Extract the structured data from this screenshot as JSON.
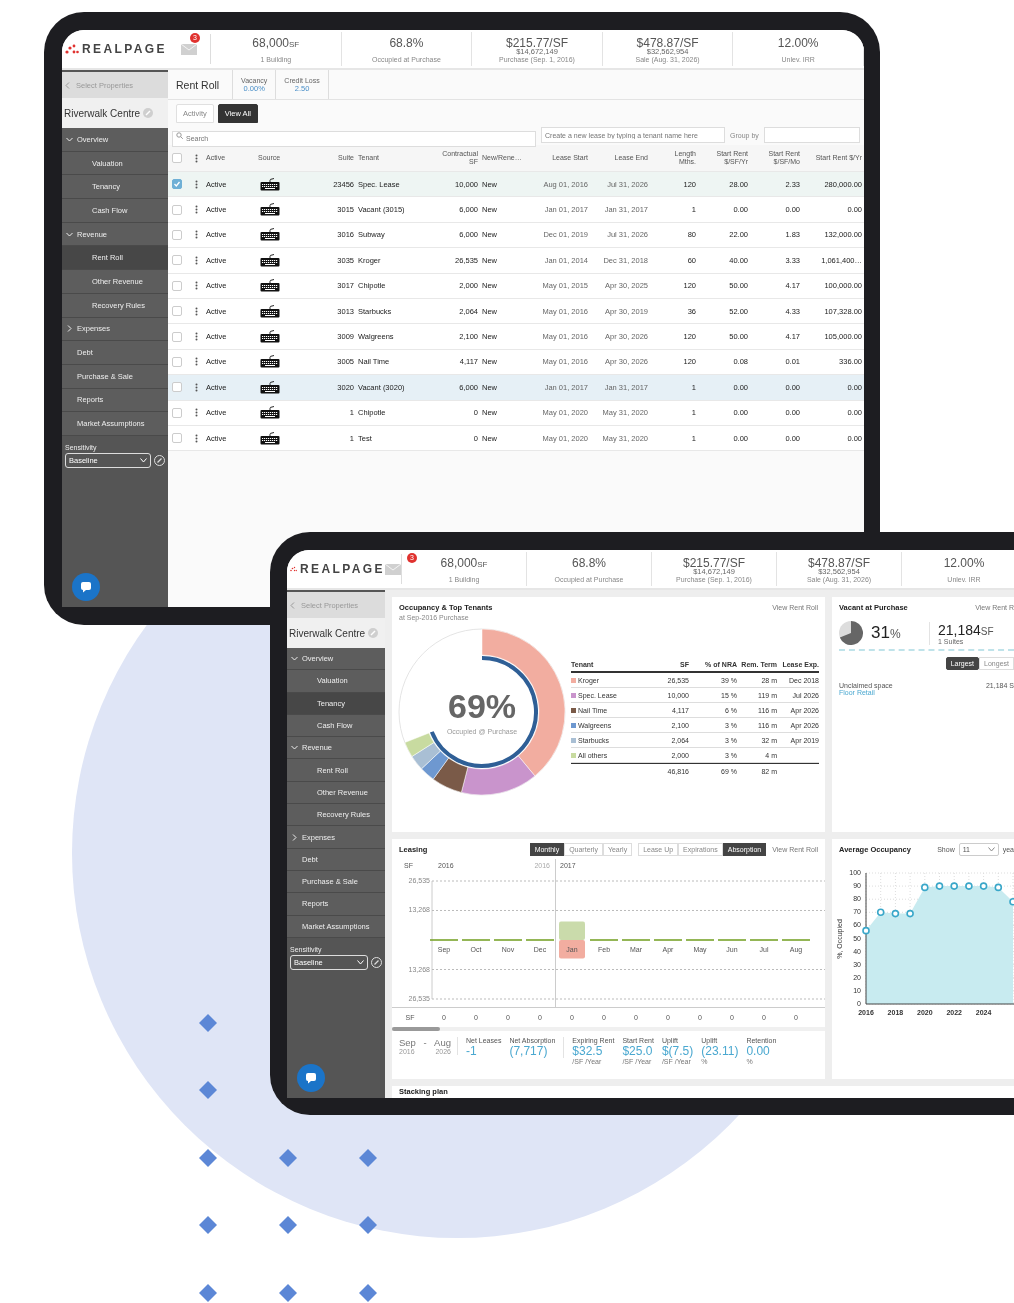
{
  "tablets": [
    {
      "kind": "rent_roll",
      "brand": "REALPAGE",
      "mail_count": "3",
      "stats": [
        {
          "value": "68,000",
          "unit": "SF",
          "caption": "1 Building"
        },
        {
          "value": "68.8%",
          "caption": "Occupied at Purchase"
        },
        {
          "value": "$215.77/SF",
          "sub": "$14,672,149",
          "caption": "Purchase (Sep. 1, 2016)"
        },
        {
          "value": "$478.87/SF",
          "sub": "$32,562,954",
          "caption": "Sale (Aug. 31, 2026)"
        },
        {
          "value": "12.00%",
          "caption": "Unlev. IRR"
        }
      ],
      "sidebar": {
        "back": "Select Properties",
        "property": "Riverwalk Centre",
        "nav": [
          {
            "label": "Overview",
            "expanded": true,
            "selected": false,
            "children": [
              {
                "label": "Valuation",
                "selected": false
              },
              {
                "label": "Tenancy",
                "selected": false
              },
              {
                "label": "Cash Flow",
                "selected": false
              }
            ]
          },
          {
            "label": "Revenue",
            "expanded": true,
            "selected": false,
            "children": [
              {
                "label": "Rent Roll",
                "selected": true
              },
              {
                "label": "Other Revenue",
                "selected": false
              },
              {
                "label": "Recovery Rules",
                "selected": false
              }
            ]
          },
          {
            "label": "Expenses",
            "expanded": false,
            "selected": false
          },
          {
            "label": "Debt",
            "selected": false
          },
          {
            "label": "Purchase & Sale",
            "selected": false
          },
          {
            "label": "Reports",
            "selected": false
          },
          {
            "label": "Market Assumptions",
            "selected": false
          }
        ],
        "sensitivity_label": "Sensitivity",
        "sensitivity": "Baseline"
      },
      "rent_roll": {
        "title": "Rent Roll",
        "metrics": [
          {
            "label": "Vacancy",
            "value": "0.00%"
          },
          {
            "label": "Credit Loss",
            "value": "2.50"
          }
        ],
        "tabs": [
          {
            "label": "Activity",
            "selected": false
          },
          {
            "label": "View All",
            "selected": true
          }
        ],
        "search": {
          "placeholder": "Search"
        },
        "new_lease": {
          "placeholder": "Create a new lease by typing a tenant name here"
        },
        "group_by": {
          "label": "Group by"
        },
        "all_checked": false,
        "columns": [
          "Active",
          "Source",
          "Suite",
          "Tenant",
          "Contractual SF",
          "New/Rene…",
          "Lease Start",
          "Lease End",
          "Length Mths.",
          "Start Rent $/SF/Yr",
          "Start Rent $/SF/Mo",
          "Start Rent $/Yr"
        ],
        "rows": [
          {
            "checked": true,
            "selected": true,
            "cells": [
              "Active",
              "",
              "23456",
              "Spec. Lease",
              "10,000",
              "New",
              "Aug 01, 2016",
              "Jul 31, 2026",
              "120",
              "28.00",
              "2.33",
              "280,000.00"
            ]
          },
          {
            "checked": false,
            "selected": false,
            "cells": [
              "Active",
              "",
              "3015",
              "Vacant (3015)",
              "6,000",
              "New",
              "Jan 01, 2017",
              "Jan 31, 2017",
              "1",
              "0.00",
              "0.00",
              "0.00"
            ]
          },
          {
            "checked": false,
            "selected": false,
            "cells": [
              "Active",
              "",
              "3016",
              "Subway",
              "6,000",
              "New",
              "Dec 01, 2019",
              "Jul 31, 2026",
              "80",
              "22.00",
              "1.83",
              "132,000.00"
            ]
          },
          {
            "checked": false,
            "selected": false,
            "cells": [
              "Active",
              "",
              "3035",
              "Kroger",
              "26,535",
              "New",
              "Jan 01, 2014",
              "Dec 31, 2018",
              "60",
              "40.00",
              "3.33",
              "1,061,400…"
            ]
          },
          {
            "checked": false,
            "selected": false,
            "cells": [
              "Active",
              "",
              "3017",
              "Chipotle",
              "2,000",
              "New",
              "May 01, 2015",
              "Apr 30, 2025",
              "120",
              "50.00",
              "4.17",
              "100,000.00"
            ]
          },
          {
            "checked": false,
            "selected": false,
            "cells": [
              "Active",
              "",
              "3013",
              "Starbucks",
              "2,064",
              "New",
              "May 01, 2016",
              "Apr 30, 2019",
              "36",
              "52.00",
              "4.33",
              "107,328.00"
            ]
          },
          {
            "checked": false,
            "selected": false,
            "cells": [
              "Active",
              "",
              "3009",
              "Walgreens",
              "2,100",
              "New",
              "May 01, 2016",
              "Apr 30, 2026",
              "120",
              "50.00",
              "4.17",
              "105,000.00"
            ]
          },
          {
            "checked": false,
            "selected": false,
            "cells": [
              "Active",
              "",
              "3005",
              "Nail Time",
              "4,117",
              "New",
              "May 01, 2016",
              "Apr 30, 2026",
              "120",
              "0.08",
              "0.01",
              "336.00"
            ]
          },
          {
            "checked": false,
            "selected": true,
            "cells": [
              "Active",
              "",
              "3020",
              "Vacant (3020)",
              "6,000",
              "New",
              "Jan 01, 2017",
              "Jan 31, 2017",
              "1",
              "0.00",
              "0.00",
              "0.00"
            ]
          },
          {
            "checked": false,
            "selected": false,
            "cells": [
              "Active",
              "",
              "1",
              "Chipotle",
              "0",
              "New",
              "May 01, 2020",
              "May 31, 2020",
              "1",
              "0.00",
              "0.00",
              "0.00"
            ]
          },
          {
            "checked": false,
            "selected": false,
            "cells": [
              "Active",
              "",
              "1",
              "Test",
              "0",
              "New",
              "May 01, 2020",
              "May 31, 2020",
              "1",
              "0.00",
              "0.00",
              "0.00"
            ]
          }
        ]
      }
    },
    {
      "kind": "dashboard",
      "brand": "REALPAGE",
      "mail_count": "3",
      "stats": [
        {
          "value": "68,000",
          "unit": "SF",
          "caption": "1 Building"
        },
        {
          "value": "68.8%",
          "caption": "Occupied at Purchase"
        },
        {
          "value": "$215.77/SF",
          "sub": "$14,672,149",
          "caption": "Purchase (Sep. 1, 2016)"
        },
        {
          "value": "$478.87/SF",
          "sub": "$32,562,954",
          "caption": "Sale (Aug. 31, 2026)"
        },
        {
          "value": "12.00%",
          "caption": "Unlev. IRR"
        }
      ],
      "sidebar": {
        "back": "Select Properties",
        "property": "Riverwalk Centre",
        "nav": [
          {
            "label": "Overview",
            "expanded": true,
            "selected": false,
            "children": [
              {
                "label": "Valuation",
                "selected": false
              },
              {
                "label": "Tenancy",
                "selected": true
              },
              {
                "label": "Cash Flow",
                "selected": false
              }
            ]
          },
          {
            "label": "Revenue",
            "expanded": true,
            "selected": false,
            "children": [
              {
                "label": "Rent Roll",
                "selected": false
              },
              {
                "label": "Other Revenue",
                "selected": false
              },
              {
                "label": "Recovery Rules",
                "selected": false
              }
            ]
          },
          {
            "label": "Expenses",
            "expanded": false,
            "selected": false
          },
          {
            "label": "Debt",
            "selected": false
          },
          {
            "label": "Purchase & Sale",
            "selected": false
          },
          {
            "label": "Reports",
            "selected": false
          },
          {
            "label": "Market Assumptions",
            "selected": false
          }
        ],
        "sensitivity_label": "Sensitivity",
        "sensitivity": "Baseline"
      },
      "dashboard": {
        "occupancy": {
          "title": "Occupancy & Top Tenants",
          "link": "View Rent Roll",
          "subtitle": "at Sep-2016 Purchase",
          "center_value": "69%",
          "center_caption": "Occupied @ Purchase",
          "columns": [
            "Tenant",
            "SF",
            "% of NRA",
            "Rem. Term",
            "Lease Exp."
          ],
          "rows": [
            {
              "color": "#f2ada0",
              "cells": [
                "Kroger",
                "26,535",
                "39 %",
                "28 m",
                "Dec 2018"
              ]
            },
            {
              "color": "#c994cc",
              "cells": [
                "Spec. Lease",
                "10,000",
                "15 %",
                "119 m",
                "Jul 2026"
              ]
            },
            {
              "color": "#7a5a48",
              "cells": [
                "Nail Time",
                "4,117",
                "6 %",
                "116 m",
                "Apr 2026"
              ]
            },
            {
              "color": "#6e98d0",
              "cells": [
                "Walgreens",
                "2,100",
                "3 %",
                "116 m",
                "Apr 2026"
              ]
            },
            {
              "color": "#a9bfd4",
              "cells": [
                "Starbucks",
                "2,064",
                "3 %",
                "32 m",
                "Apr 2019"
              ]
            },
            {
              "color": "#c8dba0",
              "cells": [
                "All others",
                "2,000",
                "3 %",
                "4 m"
              ]
            }
          ],
          "total": [
            "46,816",
            "69 %",
            "82 m"
          ]
        },
        "vacant": {
          "title": "Vacant at Purchase",
          "link": "View Rent R",
          "percent": "31",
          "percent_unit": "%",
          "area": "21,184",
          "area_unit": "SF",
          "suites": "1 Suites",
          "toggles": [
            {
              "label": "Largest",
              "selected": true
            },
            {
              "label": "Longest",
              "selected": false
            }
          ],
          "items": [
            {
              "name": "Unclaimed space",
              "type": "Floor Retail",
              "area": "21,184 S"
            }
          ]
        },
        "leasing": {
          "title": "Leasing",
          "periods": [
            {
              "label": "Monthly",
              "selected": true
            },
            {
              "label": "Quarterly",
              "selected": false
            },
            {
              "label": "Yearly",
              "selected": false
            }
          ],
          "views": [
            {
              "label": "Lease Up",
              "selected": false
            },
            {
              "label": "Expirations",
              "selected": false
            },
            {
              "label": "Absorption",
              "selected": true
            }
          ],
          "link": "View Rent Roll",
          "year_labels": [
            "2016",
            "2016",
            "2017"
          ],
          "chart_data": {
            "type": "bar",
            "ylabel": "SF",
            "stacked": true,
            "categories": [
              "Sep",
              "Oct",
              "Nov",
              "Dec",
              "Jan",
              "Feb",
              "Mar",
              "Apr",
              "May",
              "Jun",
              "Jul",
              "Aug"
            ],
            "series": [
              {
                "color": "#7aa52d",
                "values": [
                  0,
                  0,
                  0,
                  0,
                  8300,
                  0,
                  0,
                  0,
                  0,
                  0,
                  0,
                  0
                ]
              },
              {
                "color": "#f2ada0",
                "values": [
                  0,
                  0,
                  0,
                  0,
                  -8300,
                  0,
                  0,
                  0,
                  0,
                  0,
                  0,
                  0
                ]
              }
            ],
            "ylim": [
              -26535,
              26535
            ],
            "yticks": [
              {
                "value": 26535,
                "label": "26,535"
              },
              {
                "value": 13268,
                "label": "13,268"
              },
              {
                "value": -13268,
                "label": "13,268"
              },
              {
                "value": -26535,
                "label": "26,535"
              }
            ]
          },
          "totals_label": "SF",
          "totals": [
            "0",
            "0",
            "0",
            "0",
            "0",
            "0",
            "0",
            "0",
            "0",
            "0",
            "0",
            "0"
          ],
          "range": {
            "from": "Sep",
            "to": "Aug",
            "separator": "-",
            "from_year": "2016",
            "to_year": "2026"
          },
          "stats": [
            {
              "label": "Net Leases",
              "value": "-1"
            },
            {
              "label": "Net Absorption",
              "value": "(7,717)"
            },
            {
              "label": "Expiring Rent",
              "value": "$32.5",
              "unit": "/SF /Year"
            },
            {
              "label": "Start Rent",
              "value": "$25.0",
              "unit": "/SF /Year"
            },
            {
              "label": "Uplift",
              "value": "$(7.5)",
              "unit": "/SF /Year"
            },
            {
              "label": "Uplift",
              "value": "(23.11)",
              "unit": "%"
            },
            {
              "label": "Retention",
              "value": "0.00",
              "unit": "%"
            }
          ]
        },
        "average": {
          "title": "Average Occupancy",
          "show_label": "Show",
          "show_value": "11",
          "show_unit": "yea",
          "chart_data": {
            "type": "area",
            "ylabel": "%, Occupied",
            "x": [
              2016,
              2017,
              2018,
              2019,
              2020,
              2021,
              2022,
              2023,
              2024,
              2025,
              2026
            ],
            "series": [
              {
                "color": "#3aa7c9",
                "values": [
                  56,
                  70,
                  69,
                  69,
                  89,
                  90,
                  90,
                  90,
                  90,
                  89,
                  78
                ]
              }
            ],
            "xlim": [
              2016,
              2026
            ],
            "ylim": [
              0,
              100
            ],
            "yticks": [
              0,
              10,
              20,
              30,
              40,
              50,
              60,
              70,
              80,
              90,
              100
            ],
            "xticks": [
              2016,
              2018,
              2020,
              2022,
              2024
            ],
            "grid": true
          }
        },
        "stacking": {
          "title": "Stacking plan"
        }
      }
    }
  ]
}
